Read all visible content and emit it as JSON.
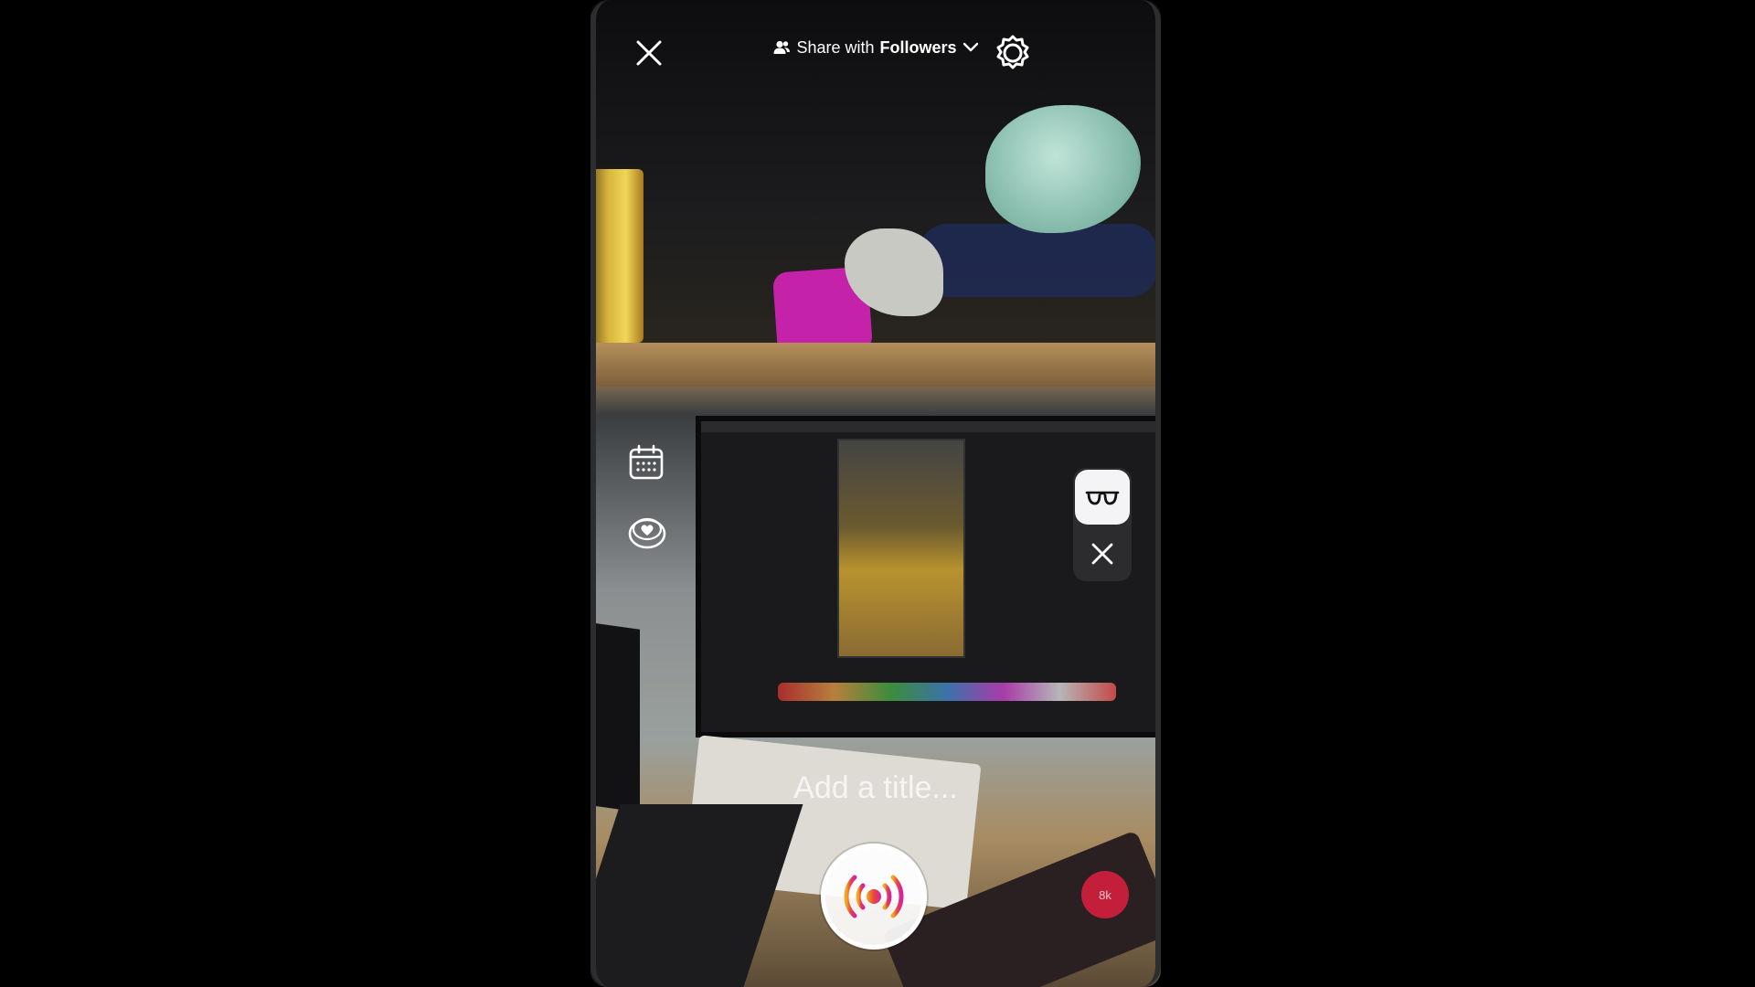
{
  "header": {
    "share_prefix": "Share with",
    "share_audience": "Followers",
    "close_icon": "close-icon",
    "settings_icon": "settings-icon"
  },
  "side_tools": {
    "calendar_icon": "calendar-icon",
    "heart_icon": "heart-icon"
  },
  "effects": {
    "active_effect_icon": "glasses-icon",
    "dismiss_icon": "close-icon"
  },
  "composer": {
    "title_placeholder": "Add a title..."
  },
  "footer": {
    "go_live_icon": "broadcast-icon",
    "viewer_badge": "8k"
  },
  "colors": {
    "accent_gradient_start": "#f5a623",
    "accent_gradient_end": "#d6249f",
    "badge": "#c41f3a"
  }
}
